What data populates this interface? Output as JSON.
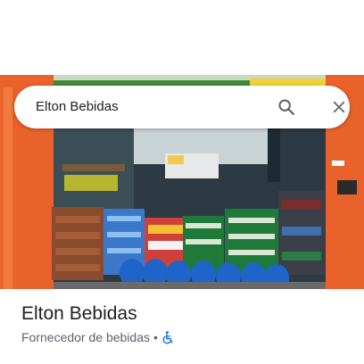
{
  "search": {
    "query": "Elton Bebidas"
  },
  "place": {
    "name": "Elton Bebidas",
    "category": "Fornecedor de bebidas",
    "separator": "•"
  },
  "icons": {
    "search": "search-icon",
    "close": "close-icon",
    "accessibility": "wheelchair-accessible-icon"
  },
  "colors": {
    "storefront_orange": "#e9622b",
    "accessibility_blue": "#1a73e8",
    "heineken_green": "#1f7a3a"
  }
}
